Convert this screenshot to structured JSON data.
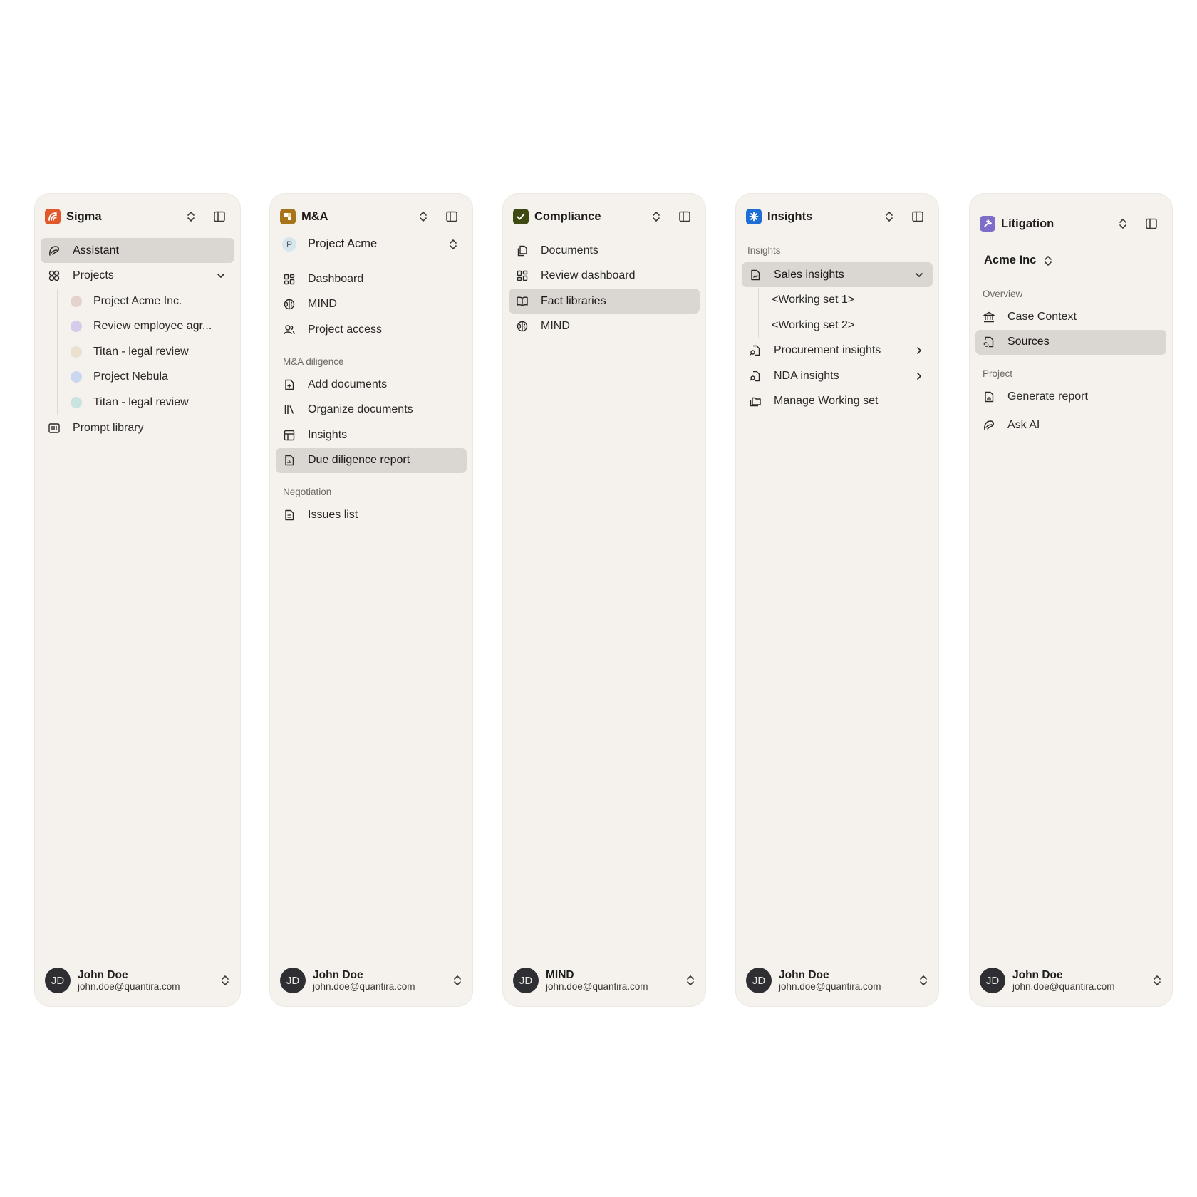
{
  "panels": {
    "sigma": {
      "title": "Sigma",
      "items": {
        "assistant": "Assistant",
        "projects": "Projects",
        "prompt_library": "Prompt library"
      },
      "projects": [
        "Project Acme Inc.",
        "Review employee agr...",
        "Titan - legal review",
        "Project Nebula",
        "Titan - legal review"
      ],
      "project_dot_colors": [
        "#e3d3cc",
        "#d5ccec",
        "#ece0cf",
        "#c9d8ee",
        "#c9e3e0"
      ],
      "user": {
        "initials": "JD",
        "name": "John Doe",
        "email": "john.doe@quantira.com"
      }
    },
    "ma": {
      "title": "M&A",
      "project": {
        "initial": "P",
        "name": "Project Acme"
      },
      "items": {
        "dashboard": "Dashboard",
        "mind": "MIND",
        "project_access": "Project access"
      },
      "section_diligence": "M&A diligence",
      "diligence": {
        "add": "Add documents",
        "organize": "Organize documents",
        "insights": "Insights",
        "report": "Due diligence report"
      },
      "section_negotiation": "Negotiation",
      "negotiation": {
        "issues": "Issues list"
      },
      "user": {
        "initials": "JD",
        "name": "John Doe",
        "email": "john.doe@quantira.com"
      }
    },
    "compliance": {
      "title": "Compliance",
      "items": {
        "documents": "Documents",
        "review_dashboard": "Review dashboard",
        "fact_libraries": "Fact libraries",
        "mind": "MIND"
      },
      "user": {
        "initials": "JD",
        "name": "MIND",
        "email": "john.doe@quantira.com"
      }
    },
    "insights": {
      "title": "Insights",
      "section": "Insights",
      "items": {
        "sales": "Sales insights",
        "ws1": "<Working set 1>",
        "ws2": "<Working set 2>",
        "procurement": "Procurement insights",
        "nda": "NDA insights",
        "manage": "Manage Working set"
      },
      "user": {
        "initials": "JD",
        "name": "John Doe",
        "email": "john.doe@quantira.com"
      }
    },
    "litigation": {
      "title": "Litigation",
      "org": "Acme Inc",
      "section_overview": "Overview",
      "overview": {
        "case_context": "Case Context",
        "sources": "Sources"
      },
      "section_project": "Project",
      "project": {
        "generate_report": "Generate report",
        "ask_ai": "Ask AI"
      },
      "user": {
        "initials": "JD",
        "name": "John Doe",
        "email": "john.doe@quantira.com"
      }
    }
  },
  "colors": {
    "sigma_logo": "#e0582c",
    "ma_logo": "#a8741a",
    "compliance_logo": "#3f4a12",
    "insights_logo": "#1d6fd6",
    "litigation_logo": "#7e6ec9",
    "active_bg": "#dad6d1",
    "panel_bg": "#f5f2ee"
  }
}
